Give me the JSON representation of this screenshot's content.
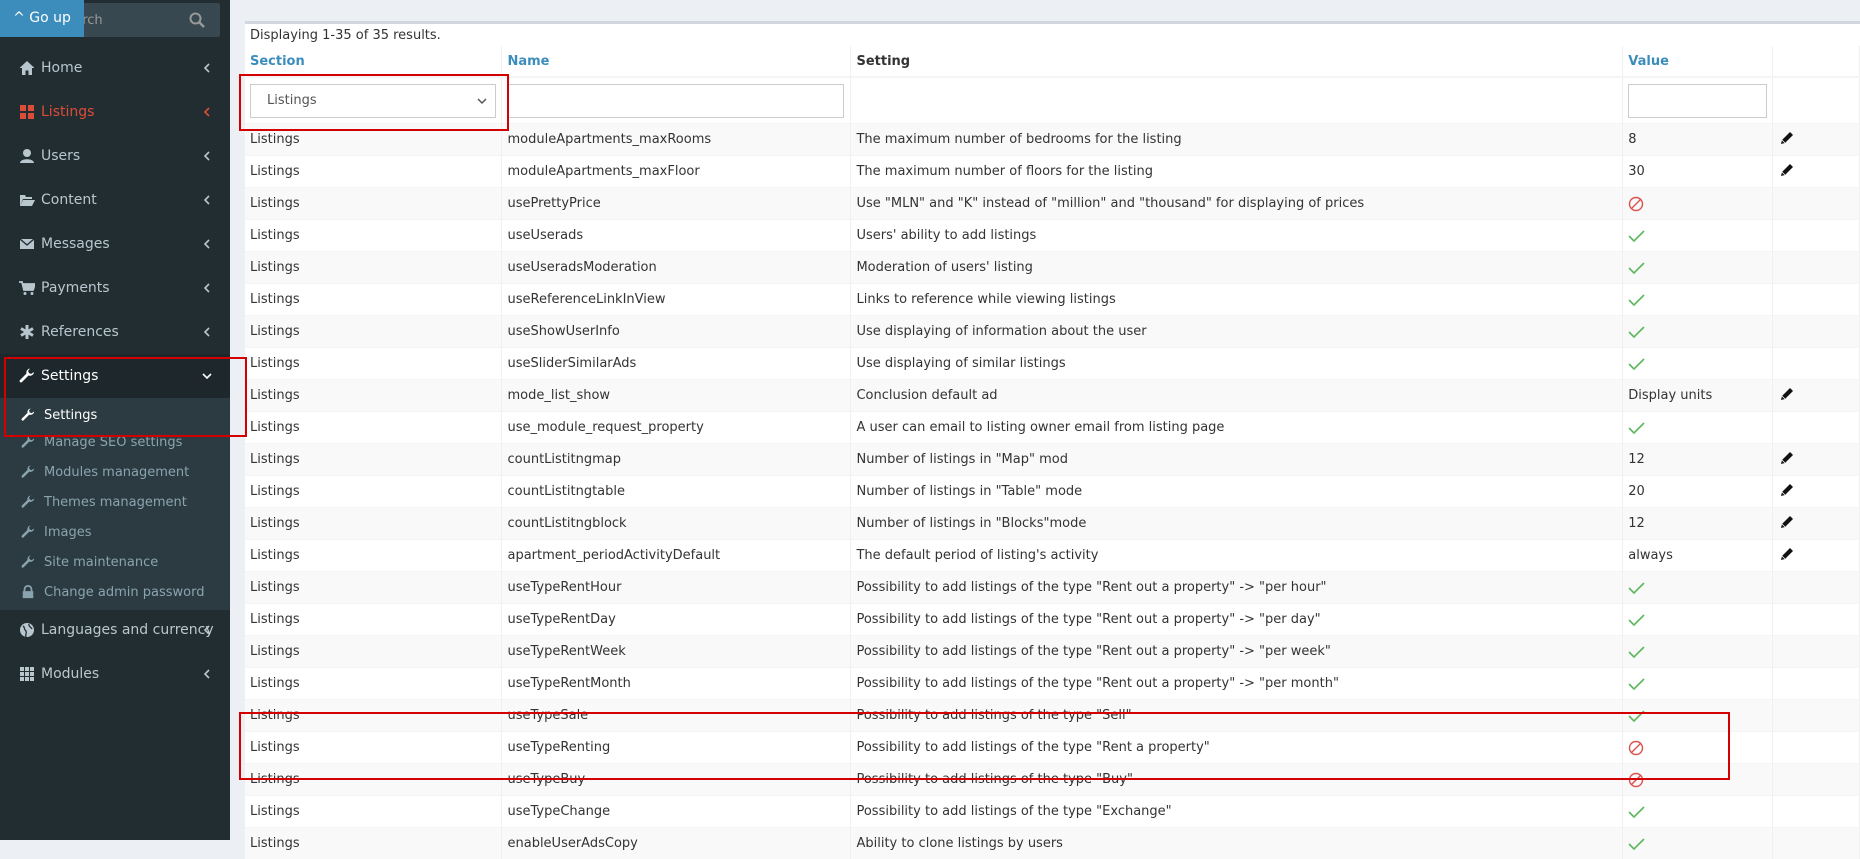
{
  "sidebar": {
    "search_placeholder": "Search",
    "go_up": "^ Go up",
    "items": [
      {
        "label": "Home",
        "icon": "home-icon"
      },
      {
        "label": "Listings",
        "icon": "grid-icon"
      },
      {
        "label": "Users",
        "icon": "user-icon"
      },
      {
        "label": "Content",
        "icon": "folder-open-icon"
      },
      {
        "label": "Messages",
        "icon": "envelope-icon"
      },
      {
        "label": "Payments",
        "icon": "cart-icon"
      },
      {
        "label": "References",
        "icon": "asterisk-icon"
      },
      {
        "label": "Settings",
        "icon": "wrench-icon"
      },
      {
        "label": "Languages and currency",
        "icon": "globe-icon"
      },
      {
        "label": "Modules",
        "icon": "apps-grid-icon"
      }
    ],
    "settings_sub": [
      {
        "label": "Settings"
      },
      {
        "label": "Manage SEO settings"
      },
      {
        "label": "Modules management"
      },
      {
        "label": "Themes management"
      },
      {
        "label": "Images"
      },
      {
        "label": "Site maintenance"
      },
      {
        "label": "Change admin password"
      }
    ]
  },
  "grid": {
    "summary": "Displaying 1-35 of 35 results.",
    "headers": {
      "section": "Section",
      "name": "Name",
      "setting": "Setting",
      "value": "Value"
    },
    "filter_section": "Listings",
    "rows": [
      {
        "section": "Listings",
        "name": "moduleApartments_maxRooms",
        "setting": "The maximum number of bedrooms for the listing",
        "value": "8",
        "value_type": "text",
        "editable": true
      },
      {
        "section": "Listings",
        "name": "moduleApartments_maxFloor",
        "setting": "The maximum number of floors for the listing",
        "value": "30",
        "value_type": "text",
        "editable": true
      },
      {
        "section": "Listings",
        "name": "usePrettyPrice",
        "setting": "Use \"MLN\" and \"K\" instead of \"million\" and \"thousand\" for displaying of prices",
        "value": "",
        "value_type": "off",
        "editable": false
      },
      {
        "section": "Listings",
        "name": "useUserads",
        "setting": "Users' ability to add listings",
        "value": "",
        "value_type": "on",
        "editable": false
      },
      {
        "section": "Listings",
        "name": "useUseradsModeration",
        "setting": "Moderation of users' listing",
        "value": "",
        "value_type": "on",
        "editable": false
      },
      {
        "section": "Listings",
        "name": "useReferenceLinkInView",
        "setting": "Links to reference while viewing listings",
        "value": "",
        "value_type": "on",
        "editable": false
      },
      {
        "section": "Listings",
        "name": "useShowUserInfo",
        "setting": "Use displaying of information about the user",
        "value": "",
        "value_type": "on",
        "editable": false
      },
      {
        "section": "Listings",
        "name": "useSliderSimilarAds",
        "setting": "Use displaying of similar listings",
        "value": "",
        "value_type": "on",
        "editable": false
      },
      {
        "section": "Listings",
        "name": "mode_list_show",
        "setting": "Conclusion default ad",
        "value": "Display units",
        "value_type": "text",
        "editable": true
      },
      {
        "section": "Listings",
        "name": "use_module_request_property",
        "setting": "A user can email to listing owner email from listing page",
        "value": "",
        "value_type": "on",
        "editable": false
      },
      {
        "section": "Listings",
        "name": "countListitngmap",
        "setting": "Number of listings in \"Map\" mod",
        "value": "12",
        "value_type": "text",
        "editable": true
      },
      {
        "section": "Listings",
        "name": "countListitngtable",
        "setting": "Number of listings in \"Table\" mode",
        "value": "20",
        "value_type": "text",
        "editable": true
      },
      {
        "section": "Listings",
        "name": "countListitngblock",
        "setting": "Number of listings in \"Blocks\"mode",
        "value": "12",
        "value_type": "text",
        "editable": true
      },
      {
        "section": "Listings",
        "name": "apartment_periodActivityDefault",
        "setting": "The default period of listing's activity",
        "value": "always",
        "value_type": "text",
        "editable": true
      },
      {
        "section": "Listings",
        "name": "useTypeRentHour",
        "setting": "Possibility to add listings of the type \"Rent out a property\" -> \"per hour\"",
        "value": "",
        "value_type": "on",
        "editable": false
      },
      {
        "section": "Listings",
        "name": "useTypeRentDay",
        "setting": "Possibility to add listings of the type \"Rent out a property\" -> \"per day\"",
        "value": "",
        "value_type": "on",
        "editable": false
      },
      {
        "section": "Listings",
        "name": "useTypeRentWeek",
        "setting": "Possibility to add listings of the type \"Rent out a property\" -> \"per week\"",
        "value": "",
        "value_type": "on",
        "editable": false
      },
      {
        "section": "Listings",
        "name": "useTypeRentMonth",
        "setting": "Possibility to add listings of the type \"Rent out a property\" -> \"per month\"",
        "value": "",
        "value_type": "on",
        "editable": false
      },
      {
        "section": "Listings",
        "name": "useTypeSale",
        "setting": "Possibility to add listings of the type \"Sell\"",
        "value": "",
        "value_type": "on",
        "editable": false
      },
      {
        "section": "Listings",
        "name": "useTypeRenting",
        "setting": "Possibility to add listings of the type \"Rent a property\"",
        "value": "",
        "value_type": "off",
        "editable": false
      },
      {
        "section": "Listings",
        "name": "useTypeBuy",
        "setting": "Possibility to add listings of the type \"Buy\"",
        "value": "",
        "value_type": "off",
        "editable": false
      },
      {
        "section": "Listings",
        "name": "useTypeChange",
        "setting": "Possibility to add listings of the type \"Exchange\"",
        "value": "",
        "value_type": "on",
        "editable": false
      },
      {
        "section": "Listings",
        "name": "enableUserAdsCopy",
        "setting": "Ability to clone listings by users",
        "value": "",
        "value_type": "on",
        "editable": false
      }
    ]
  },
  "colors": {
    "sidebar_bg": "#222d32",
    "accent": "#3c8dbc",
    "active_red": "#dd4b39",
    "check_green": "#5cb85c",
    "off_red": "#d9534f",
    "highlight": "#d40000"
  }
}
